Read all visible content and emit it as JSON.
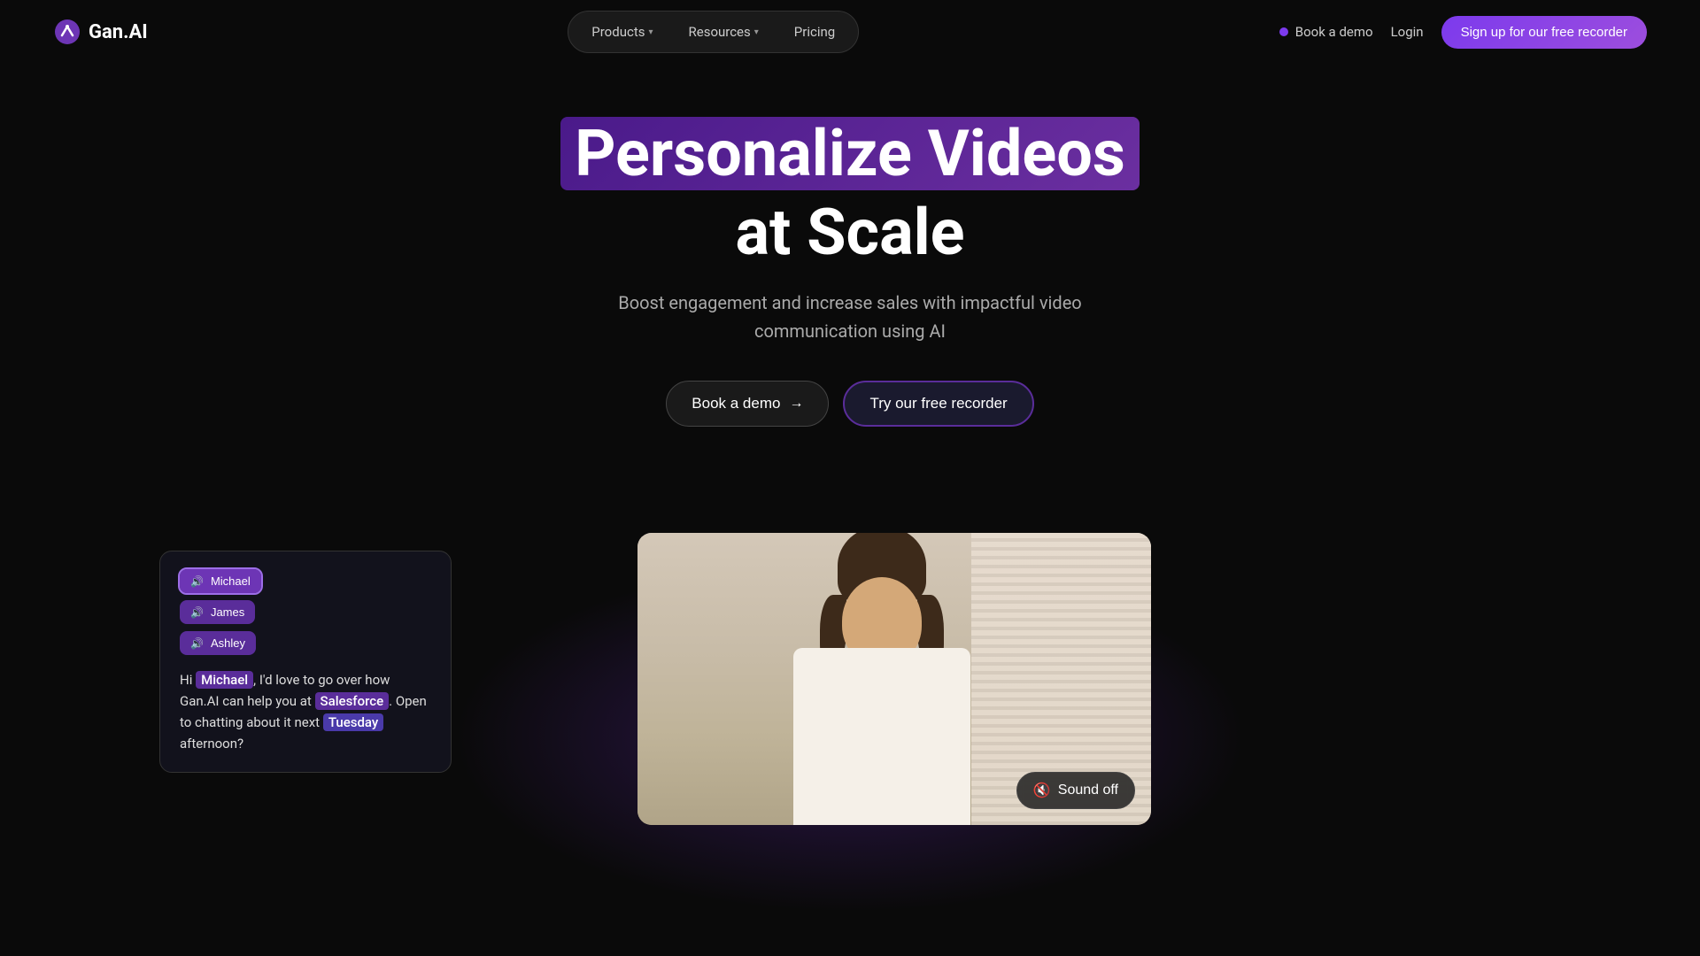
{
  "logo": {
    "text": "Gan.AI"
  },
  "nav": {
    "products_label": "Products",
    "resources_label": "Resources",
    "pricing_label": "Pricing",
    "book_demo_label": "Book a demo",
    "login_label": "Login",
    "signup_label": "Sign up for our free recorder"
  },
  "hero": {
    "title_line1": "Personalize Videos",
    "title_line2": "at Scale",
    "subtitle_line1": "Boost engagement and increase sales with impactful video",
    "subtitle_line2": "communication using AI",
    "btn_demo": "Book a demo",
    "btn_recorder": "Try our free recorder"
  },
  "video": {
    "sound_off_label": "Sound off"
  },
  "persona_card": {
    "name1": "Michael",
    "name2": "James",
    "name3": "Ashley",
    "speech_pre": "Hi ",
    "speech_name": "Michael",
    "speech_mid1": ", I'd love to go over how Gan.AI can help you at ",
    "speech_company": "Salesforce",
    "speech_mid2": ". Open to chatting about it next ",
    "speech_day": "Tuesday",
    "speech_end": " afternoon?"
  }
}
